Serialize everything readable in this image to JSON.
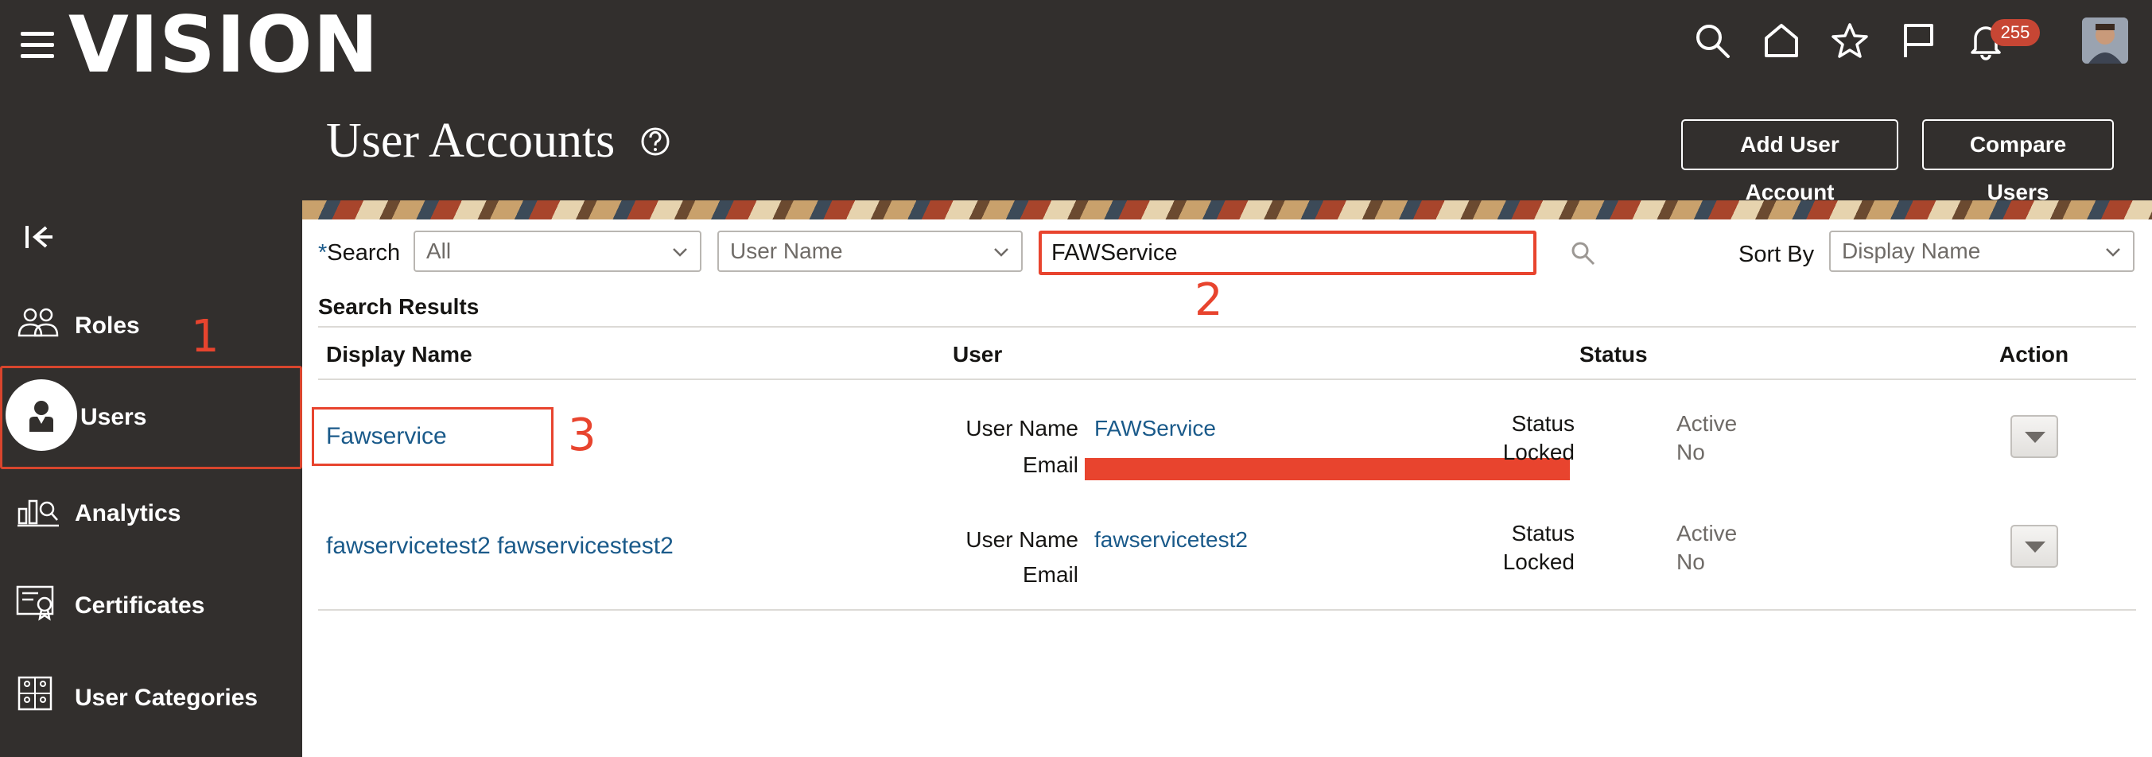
{
  "app": {
    "logo": "VISION",
    "notification_count": "255"
  },
  "header": {
    "title": "User Accounts",
    "add_button": "Add User Account",
    "compare_button": "Compare Users"
  },
  "sidebar": {
    "items": [
      {
        "label": "Roles",
        "icon": "roles-icon"
      },
      {
        "label": "Users",
        "icon": "user-icon",
        "selected": true
      },
      {
        "label": "Analytics",
        "icon": "analytics-icon"
      },
      {
        "label": "Certificates",
        "icon": "certificate-icon"
      },
      {
        "label": "User Categories",
        "icon": "user-categories-icon"
      }
    ]
  },
  "search": {
    "label": "Search",
    "required_mark": "*",
    "scope_value": "All",
    "field_value": "User Name",
    "query": "FAWService",
    "sort_label": "Sort By",
    "sort_value": "Display Name"
  },
  "results": {
    "title": "Search Results",
    "columns": [
      "Display Name",
      "User",
      "Status",
      "Action"
    ],
    "field_labels": {
      "user_name": "User Name",
      "email": "Email",
      "status": "Status",
      "locked": "Locked"
    },
    "rows": [
      {
        "display_name": "Fawservice",
        "user_name": "FAWService",
        "email": "",
        "status": "Active",
        "locked": "No"
      },
      {
        "display_name": "fawservicetest2 fawservicestest2",
        "user_name": "fawservicetest2",
        "email": "",
        "status": "Active",
        "locked": "No"
      }
    ]
  },
  "annotations": [
    "1",
    "2",
    "3"
  ],
  "colors": {
    "header_bg": "#322f2d",
    "link": "#1a5a8a",
    "annotation": "#e8442e",
    "badge": "#c74634"
  }
}
